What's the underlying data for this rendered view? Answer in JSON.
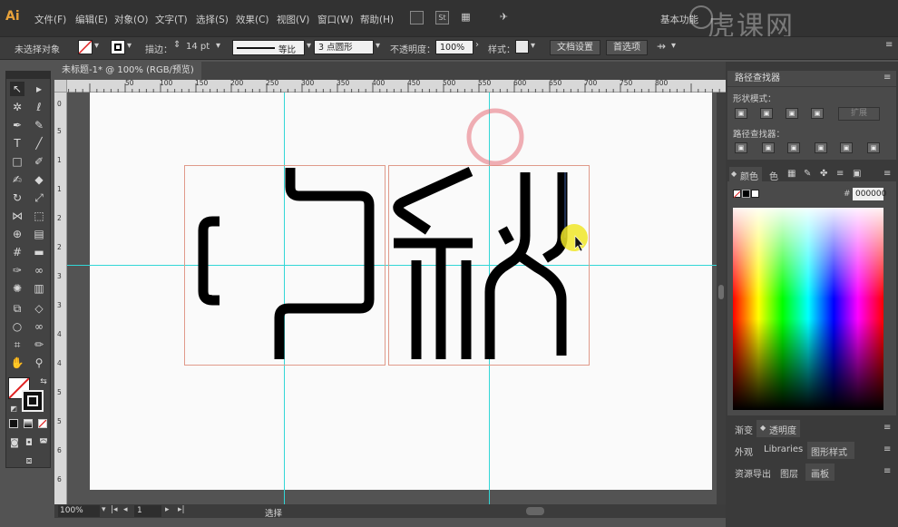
{
  "app": {
    "logo": "Ai"
  },
  "menu": [
    "文件(F)",
    "编辑(E)",
    "对象(O)",
    "文字(T)",
    "选择(S)",
    "效果(C)",
    "视图(V)",
    "窗口(W)",
    "帮助(H)"
  ],
  "menu_icons": {
    "stock": "St"
  },
  "workspace_label": "基本功能",
  "control": {
    "selection": "未选择对象",
    "stroke_label": "描边：",
    "stroke_value": "14 pt",
    "stroke_profile": "等比",
    "brush": "3 点圆形",
    "opacity_label": "不透明度：",
    "opacity_value": "100%",
    "style_label": "样式：",
    "doc_setup": "文档设置",
    "preferences": "首选项"
  },
  "document": {
    "tab": "未标题-1* @ 100% (RGB/预览)",
    "close": "×"
  },
  "ruler": {
    "h_ticks": [
      "50",
      "100",
      "150",
      "200",
      "250",
      "300",
      "350",
      "400",
      "450",
      "500",
      "550",
      "600",
      "650",
      "700",
      "750",
      "800"
    ],
    "v_ticks": [
      "0",
      "5",
      "1",
      "1",
      "2",
      "2",
      "3",
      "3",
      "4",
      "4",
      "5",
      "5",
      "6",
      "6"
    ]
  },
  "artwork": {
    "glyphs": [
      "中",
      "秋"
    ],
    "stroke_color": "#000000",
    "guide_color": "#33d6d6",
    "box_color": "#e09a8a"
  },
  "status": {
    "zoom": "100%",
    "artboard": "1",
    "tool": "选择"
  },
  "panels": {
    "pathfinder": {
      "title": "路径查找器",
      "shape_modes": "形状模式：",
      "expand": "扩展",
      "pathfinders": "路径查找器："
    },
    "color": {
      "tabs": [
        "颜色",
        "色",
        "",
        "",
        "",
        ""
      ],
      "hex": "000000"
    },
    "transparency_tabs": [
      "渐变",
      "透明度"
    ],
    "libraries_tabs": [
      "外观",
      "Libraries",
      "图形样式"
    ],
    "artboards_tabs": [
      "资源导出",
      "图层",
      "画板"
    ]
  },
  "watermark": "虎课网"
}
